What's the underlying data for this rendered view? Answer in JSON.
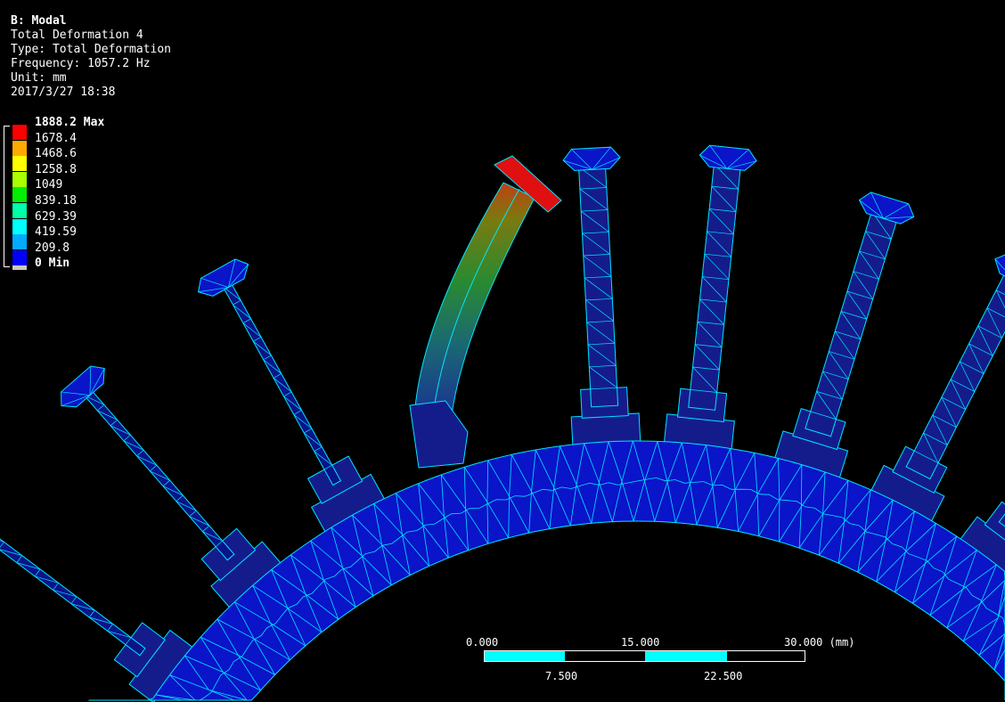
{
  "header": {
    "title": "B: Modal",
    "lines": [
      "Total Deformation 4",
      "Type: Total Deformation",
      "Frequency: 1057.2 Hz",
      "Unit: mm",
      "2017/3/27 18:38"
    ]
  },
  "legend": {
    "max_label": "1888.2 Max",
    "min_label": "0 Min",
    "levels": [
      "1678.4",
      "1468.6",
      "1258.8",
      "1049",
      "839.18",
      "629.39",
      "419.59",
      "209.8"
    ],
    "colors": [
      "#ff0000",
      "#ffaa00",
      "#ffff00",
      "#aaff00",
      "#00ee00",
      "#00ffaa",
      "#00ffff",
      "#00aaff",
      "#0000ff"
    ]
  },
  "scale_bar": {
    "ticks_top": [
      "0.000",
      "15.000",
      "30.000 (mm)"
    ],
    "ticks_bottom": [
      "7.500",
      "22.500"
    ],
    "color": "#00ffff"
  },
  "colors": {
    "mesh_fill": "#0a14c8",
    "mesh_dark": "#141c8c",
    "mesh_line": "#00e5ff"
  }
}
